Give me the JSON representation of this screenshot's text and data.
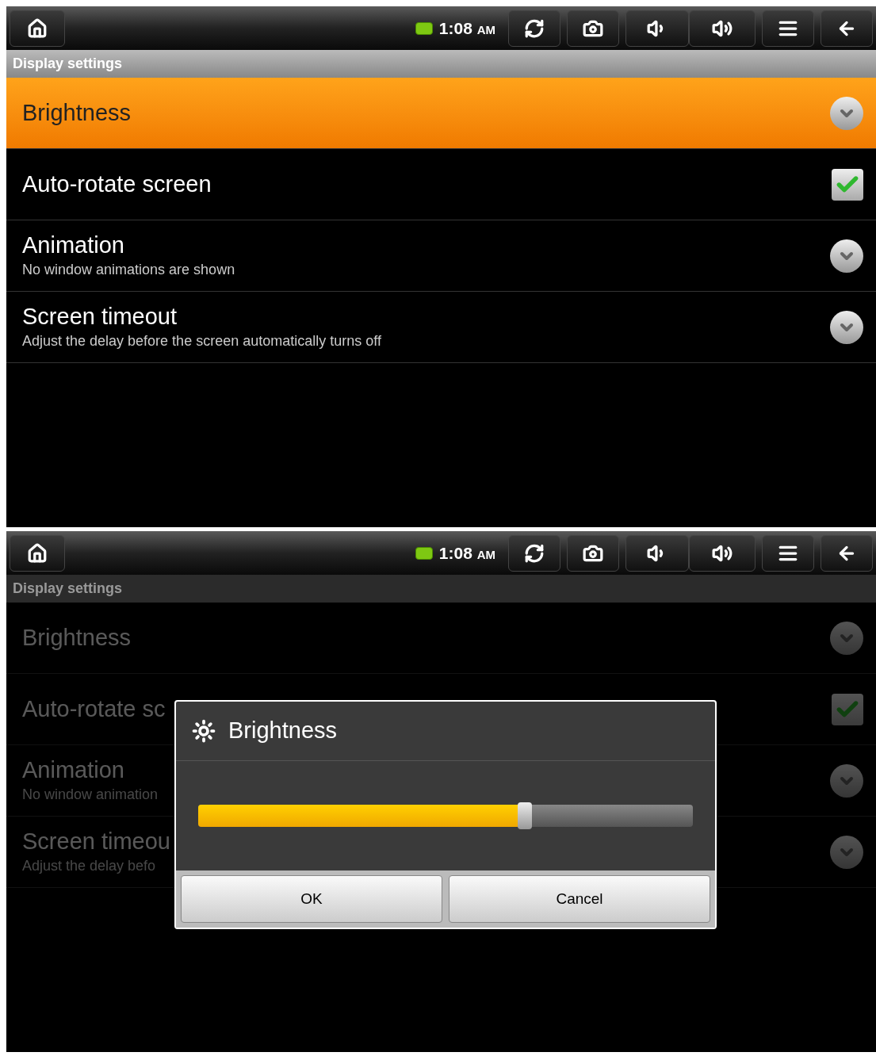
{
  "screens": [
    {
      "status_bar": {
        "time": "1:08",
        "ampm": "AM"
      },
      "title": "Display settings",
      "dimmed": false,
      "items": [
        {
          "title": "Brightness",
          "kind": "dialog",
          "selected": true
        },
        {
          "title": "Auto-rotate screen",
          "kind": "checkbox",
          "checked": true,
          "selected": false
        },
        {
          "title": "Animation",
          "summary": "No window animations are shown",
          "kind": "dialog",
          "selected": false
        },
        {
          "title": "Screen timeout",
          "summary": "Adjust the delay before the screen automatically turns off",
          "kind": "dialog",
          "selected": false
        }
      ]
    },
    {
      "status_bar": {
        "time": "1:08",
        "ampm": "AM"
      },
      "title": "Display settings",
      "dimmed": true,
      "items": [
        {
          "title": "Brightness",
          "kind": "dialog",
          "selected": false
        },
        {
          "title": "Auto-rotate sc",
          "kind": "checkbox",
          "checked": true,
          "selected": false
        },
        {
          "title": "Animation",
          "summary": "No window animation",
          "kind": "dialog",
          "selected": false
        },
        {
          "title": "Screen timeou",
          "summary": "Adjust the delay befo",
          "kind": "dialog",
          "selected": false
        }
      ],
      "dialog": {
        "title": "Brightness",
        "level": 0.66,
        "buttons": [
          "OK",
          "Cancel"
        ]
      }
    }
  ]
}
